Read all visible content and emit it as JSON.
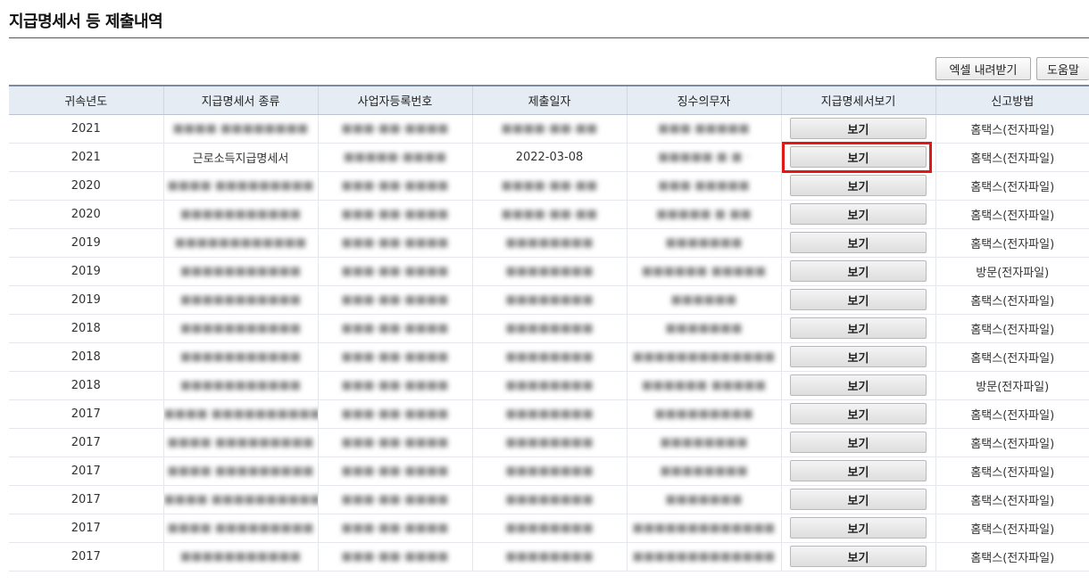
{
  "page": {
    "title": "지급명세서 등 제출내역"
  },
  "toolbar": {
    "excel_label": "엑셀 내려받기",
    "help_label": "도움말"
  },
  "table": {
    "headers": [
      "귀속년도",
      "지급명세서 종류",
      "사업자등록번호",
      "제출일자",
      "징수의무자",
      "지급명세서보기",
      "신고방법"
    ],
    "view_label": "보기",
    "rows": [
      {
        "year": "2021",
        "type": "■■■■ ■■■■■■■■",
        "bizno": "■■■-■■-■■■■",
        "date": "■■■■-■■-■■",
        "payer": "■■■ ■■■■■",
        "method": "홈택스(전자파일)"
      },
      {
        "year": "2021",
        "type": "근로소득지급명세서",
        "bizno": "■■■■■-■■■■",
        "date": "2022-03-08",
        "payer": "■■■■■ ■ ■ ·",
        "method": "홈택스(전자파일)"
      },
      {
        "year": "2020",
        "type": "■■■■ ■■■■■■■■■",
        "bizno": "■■■-■■-■■■■",
        "date": "■■■■-■■-■■",
        "payer": "■■■ ■■■■■",
        "method": "홈택스(전자파일)"
      },
      {
        "year": "2020",
        "type": "■■■■■■■■■■■",
        "bizno": "■■■-■■-■■■■",
        "date": "■■■■-■■-■■",
        "payer": "■■■■■ ■ ■■",
        "method": "홈택스(전자파일)"
      },
      {
        "year": "2019",
        "type": "■■■■■■■■■■■■",
        "bizno": "■■■-■■-■■■■",
        "date": "■■■■■■■■",
        "payer": "■■■■■■■",
        "method": "홈택스(전자파일)"
      },
      {
        "year": "2019",
        "type": "■■■■■■■■■■■",
        "bizno": "■■■-■■-■■■■",
        "date": "■■■■■■■■",
        "payer": "■■■■■■ ■■■■■",
        "method": "방문(전자파일)"
      },
      {
        "year": "2019",
        "type": "■■■■■■■■■■■",
        "bizno": "■■■-■■-■■■■",
        "date": "■■■■■■■■",
        "payer": "■■■■■■",
        "method": "홈택스(전자파일)"
      },
      {
        "year": "2018",
        "type": "■■■■■■■■■■■",
        "bizno": "■■■-■■-■■■■",
        "date": "■■■■■■■■",
        "payer": "■■■■■■■",
        "method": "홈택스(전자파일)"
      },
      {
        "year": "2018",
        "type": "■■■■■■■■■■■",
        "bizno": "■■■-■■-■■■■",
        "date": "■■■■■■■■",
        "payer": "■■■■■■■■■■■■■",
        "method": "홈택스(전자파일)"
      },
      {
        "year": "2018",
        "type": "■■■■■■■■■■■",
        "bizno": "■■■-■■-■■■■",
        "date": "■■■■■■■■",
        "payer": "■■■■■■ ■■■■■",
        "method": "방문(전자파일)"
      },
      {
        "year": "2017",
        "type": "■■■■ ■■■■■■■■■■",
        "bizno": "■■■-■■-■■■■",
        "date": "■■■■■■■■",
        "payer": "■■■■■■■■■",
        "method": "홈택스(전자파일)"
      },
      {
        "year": "2017",
        "type": "■■■■ ■■■■■■■■■",
        "bizno": "■■■-■■-■■■■",
        "date": "■■■■■■■■",
        "payer": "■■■■■■■■",
        "method": "홈택스(전자파일)"
      },
      {
        "year": "2017",
        "type": "■■■■ ■■■■■■■■■",
        "bizno": "■■■-■■-■■■■",
        "date": "■■■■■■■■",
        "payer": "■■■■■■■■",
        "method": "홈택스(전자파일)"
      },
      {
        "year": "2017",
        "type": "■■■■ ■■■■■■■■■■",
        "bizno": "■■■-■■-■■■■",
        "date": "■■■■■■■■",
        "payer": "■■■■■■■",
        "method": "홈택스(전자파일)"
      },
      {
        "year": "2017",
        "type": "■■■■ ■■■■■■■■■",
        "bizno": "■■■-■■-■■■■",
        "date": "■■■■■■■■",
        "payer": "■■■■■■■■■■■■■",
        "method": "홈택스(전자파일)"
      },
      {
        "year": "2017",
        "type": "■■■■■■■■■■■",
        "bizno": "■■■-■■-■■■■",
        "date": "■■■■■■■■",
        "payer": "■■■■■■■■■■■■■",
        "method": "홈택스(전자파일)"
      }
    ],
    "highlighted_row": 1
  },
  "colors": {
    "header_bg": "#e6ecf4",
    "highlight_border": "#e01818"
  }
}
